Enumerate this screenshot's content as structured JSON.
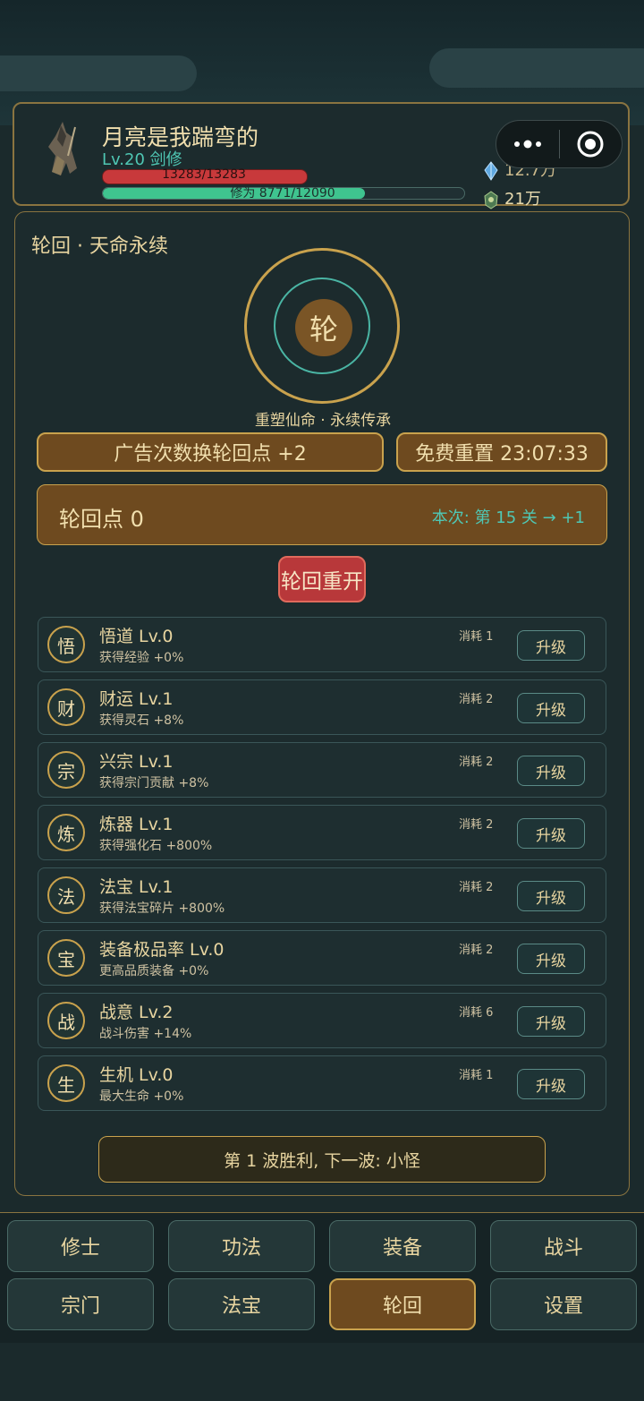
{
  "player": {
    "name": "月亮是我踹弯的",
    "level": "Lv.20 剑修",
    "hp_text": "13283/13283",
    "xp_text": "修为 8771/12090",
    "xp_progress": 0.7255
  },
  "resources": {
    "spirit": "12.7万",
    "gold": "21万"
  },
  "panel": {
    "title": "轮回 · 天命永续",
    "wheel_char": "轮",
    "subtitle": "重塑仙命 · 永续传承",
    "ad_button": "广告次数换轮回点  +2",
    "free_reset": "免费重置 23:07:33",
    "points_label": "轮回点  0",
    "points_info": "本次: 第 15 关 → +1",
    "restart_button": "轮回重开"
  },
  "upgrades": [
    {
      "badge": "悟",
      "name": "悟道  Lv.0",
      "desc": "获得经验 +0%",
      "cost": "消耗 1",
      "button": "升级"
    },
    {
      "badge": "财",
      "name": "财运  Lv.1",
      "desc": "获得灵石 +8%",
      "cost": "消耗 2",
      "button": "升级"
    },
    {
      "badge": "宗",
      "name": "兴宗  Lv.1",
      "desc": "获得宗门贡献 +8%",
      "cost": "消耗 2",
      "button": "升级"
    },
    {
      "badge": "炼",
      "name": "炼器  Lv.1",
      "desc": "获得强化石 +800%",
      "cost": "消耗 2",
      "button": "升级"
    },
    {
      "badge": "法",
      "name": "法宝  Lv.1",
      "desc": "获得法宝碎片 +800%",
      "cost": "消耗 2",
      "button": "升级"
    },
    {
      "badge": "宝",
      "name": "装备极品率  Lv.0",
      "desc": "更高品质装备 +0%",
      "cost": "消耗 2",
      "button": "升级"
    },
    {
      "badge": "战",
      "name": "战意  Lv.2",
      "desc": "战斗伤害 +14%",
      "cost": "消耗 6",
      "button": "升级"
    },
    {
      "badge": "生",
      "name": "生机  Lv.0",
      "desc": "最大生命 +0%",
      "cost": "消耗 1",
      "button": "升级"
    }
  ],
  "wave_status": "第 1 波胜利, 下一波: 小怪",
  "nav": [
    "修士",
    "功法",
    "装备",
    "战斗",
    "宗门",
    "法宝",
    "轮回",
    "设置"
  ],
  "nav_active": "轮回",
  "colors": {
    "gold_border": "#c9a24d",
    "brown_button": "#6e4a1f",
    "teal_text": "#4fc7b4",
    "hp_red": "#c8393b",
    "xp_green": "#3fc48f",
    "restart_red": "#b8383a"
  }
}
